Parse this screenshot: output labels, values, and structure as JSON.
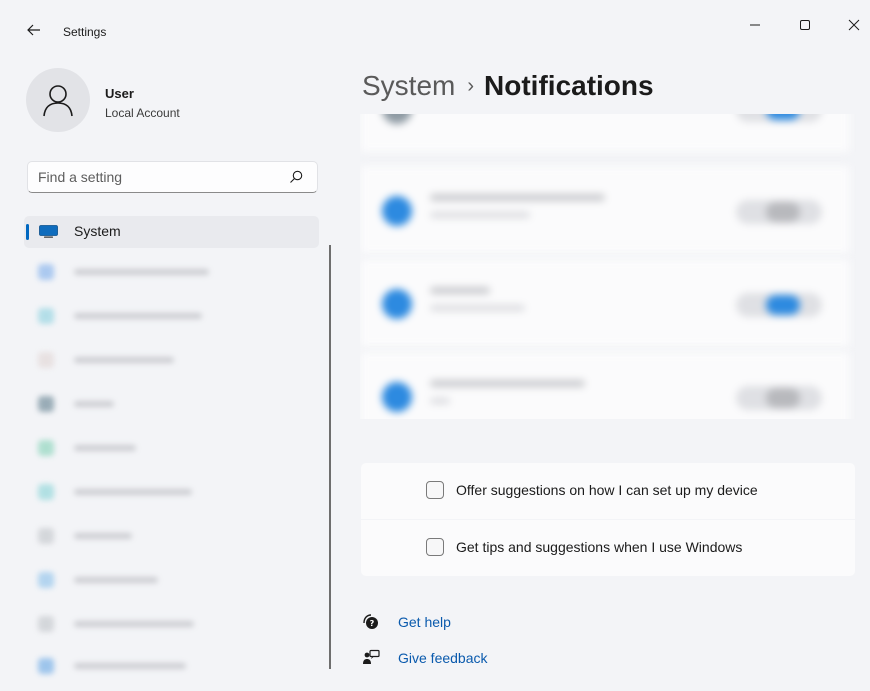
{
  "window": {
    "title": "Settings",
    "controls": [
      "minimize-icon",
      "maximize-icon",
      "close-icon"
    ]
  },
  "user": {
    "name": "User",
    "account_type": "Local Account"
  },
  "search": {
    "placeholder": "Find a setting",
    "value": ""
  },
  "nav": {
    "selected": {
      "label": "System",
      "icon": "monitor-icon"
    }
  },
  "header": {
    "breadcrumb_parent": "System",
    "separator": "›",
    "current": "Notifications"
  },
  "suggestions": [
    {
      "label": "Offer suggestions on how I can set up my device",
      "checked": false
    },
    {
      "label": "Get tips and suggestions when I use Windows",
      "checked": false
    }
  ],
  "help_links": [
    {
      "label": "Get help",
      "icon": "help-icon"
    },
    {
      "label": "Give feedback",
      "icon": "feedback-icon"
    }
  ],
  "colors": {
    "accent": "#0067c0",
    "link": "#0a5aad",
    "background": "#f3f4f7",
    "card": "#fbfbfc"
  }
}
